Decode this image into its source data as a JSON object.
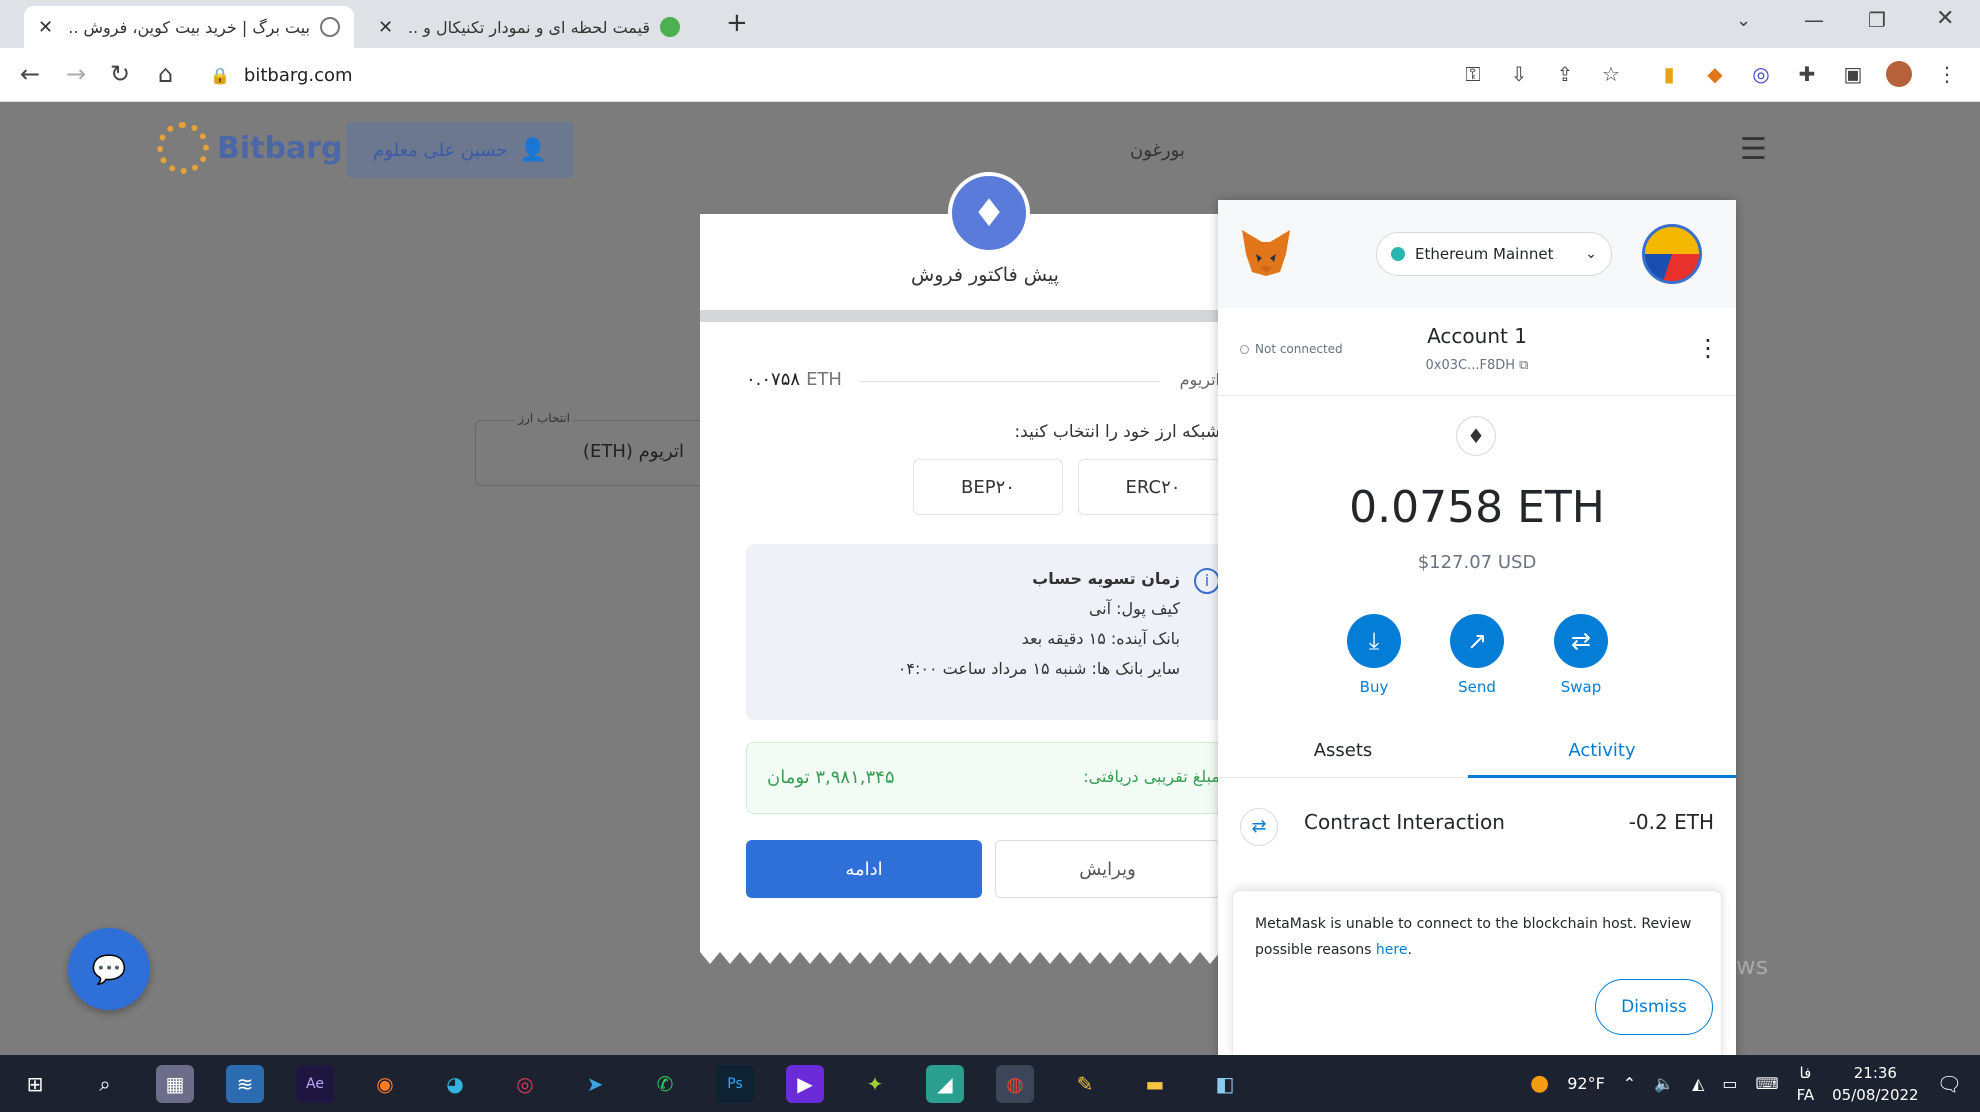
{
  "browser": {
    "tabs": [
      {
        "title": "بیت برگ | خرید بیت کوین، فروش ...",
        "active": true
      },
      {
        "title": "قیمت لحظه ای و نمودار تکنیکال و ...",
        "active": false
      }
    ],
    "url": "bitbarg.com"
  },
  "site": {
    "logo_text": "Bitbarg",
    "user_name": "حسین علی معلوم",
    "nav_item": "بورغون",
    "source_label": "انتخاب ارز",
    "source_value": "(ETH) اتریوم",
    "watermark": "Activate Windows"
  },
  "invoice": {
    "title": "پیش فاکتور فروش",
    "amount_value": "۰.۰۷۵۸",
    "amount_unit": "ETH",
    "amount_label": "اتریوم",
    "network_question": "شبکه ارز خود را انتخاب کنید:",
    "networks": [
      "BEP۲۰",
      "ERC۲۰"
    ],
    "info_title": "زمان تسویه حساب",
    "info_lines": [
      "کیف پول: آنی",
      "بانک آینده: ۱۵ دقیقه بعد",
      "سایر بانک ها: شنبه ۱۵ مرداد ساعت ۰۴:۰۰"
    ],
    "total_label": "مبلغ تقریبی دریافتی:",
    "total_value": "۳,۹۸۱,۳۴۵ تومان",
    "continue_label": "ادامه",
    "edit_label": "ویرایش"
  },
  "metamask": {
    "network": "Ethereum Mainnet",
    "connection": "Not connected",
    "account_name": "Account 1",
    "account_address": "0x03C...F8DH",
    "balance": "0.0758 ETH",
    "balance_usd": "$127.07 USD",
    "actions": [
      "Buy",
      "Send",
      "Swap"
    ],
    "tabs": [
      "Assets",
      "Activity"
    ],
    "transaction": {
      "title": "Contract Interaction",
      "amount": "-0.2 ETH"
    },
    "alert": {
      "text": "MetaMask is unable to connect to the blockchain host. Review possible reasons",
      "link": "here",
      "dismiss": "Dismiss"
    }
  },
  "taskbar": {
    "weather": "92°F",
    "lang_top": "فا",
    "lang_bottom": "FA",
    "time": "21:36",
    "date": "05/08/2022"
  }
}
